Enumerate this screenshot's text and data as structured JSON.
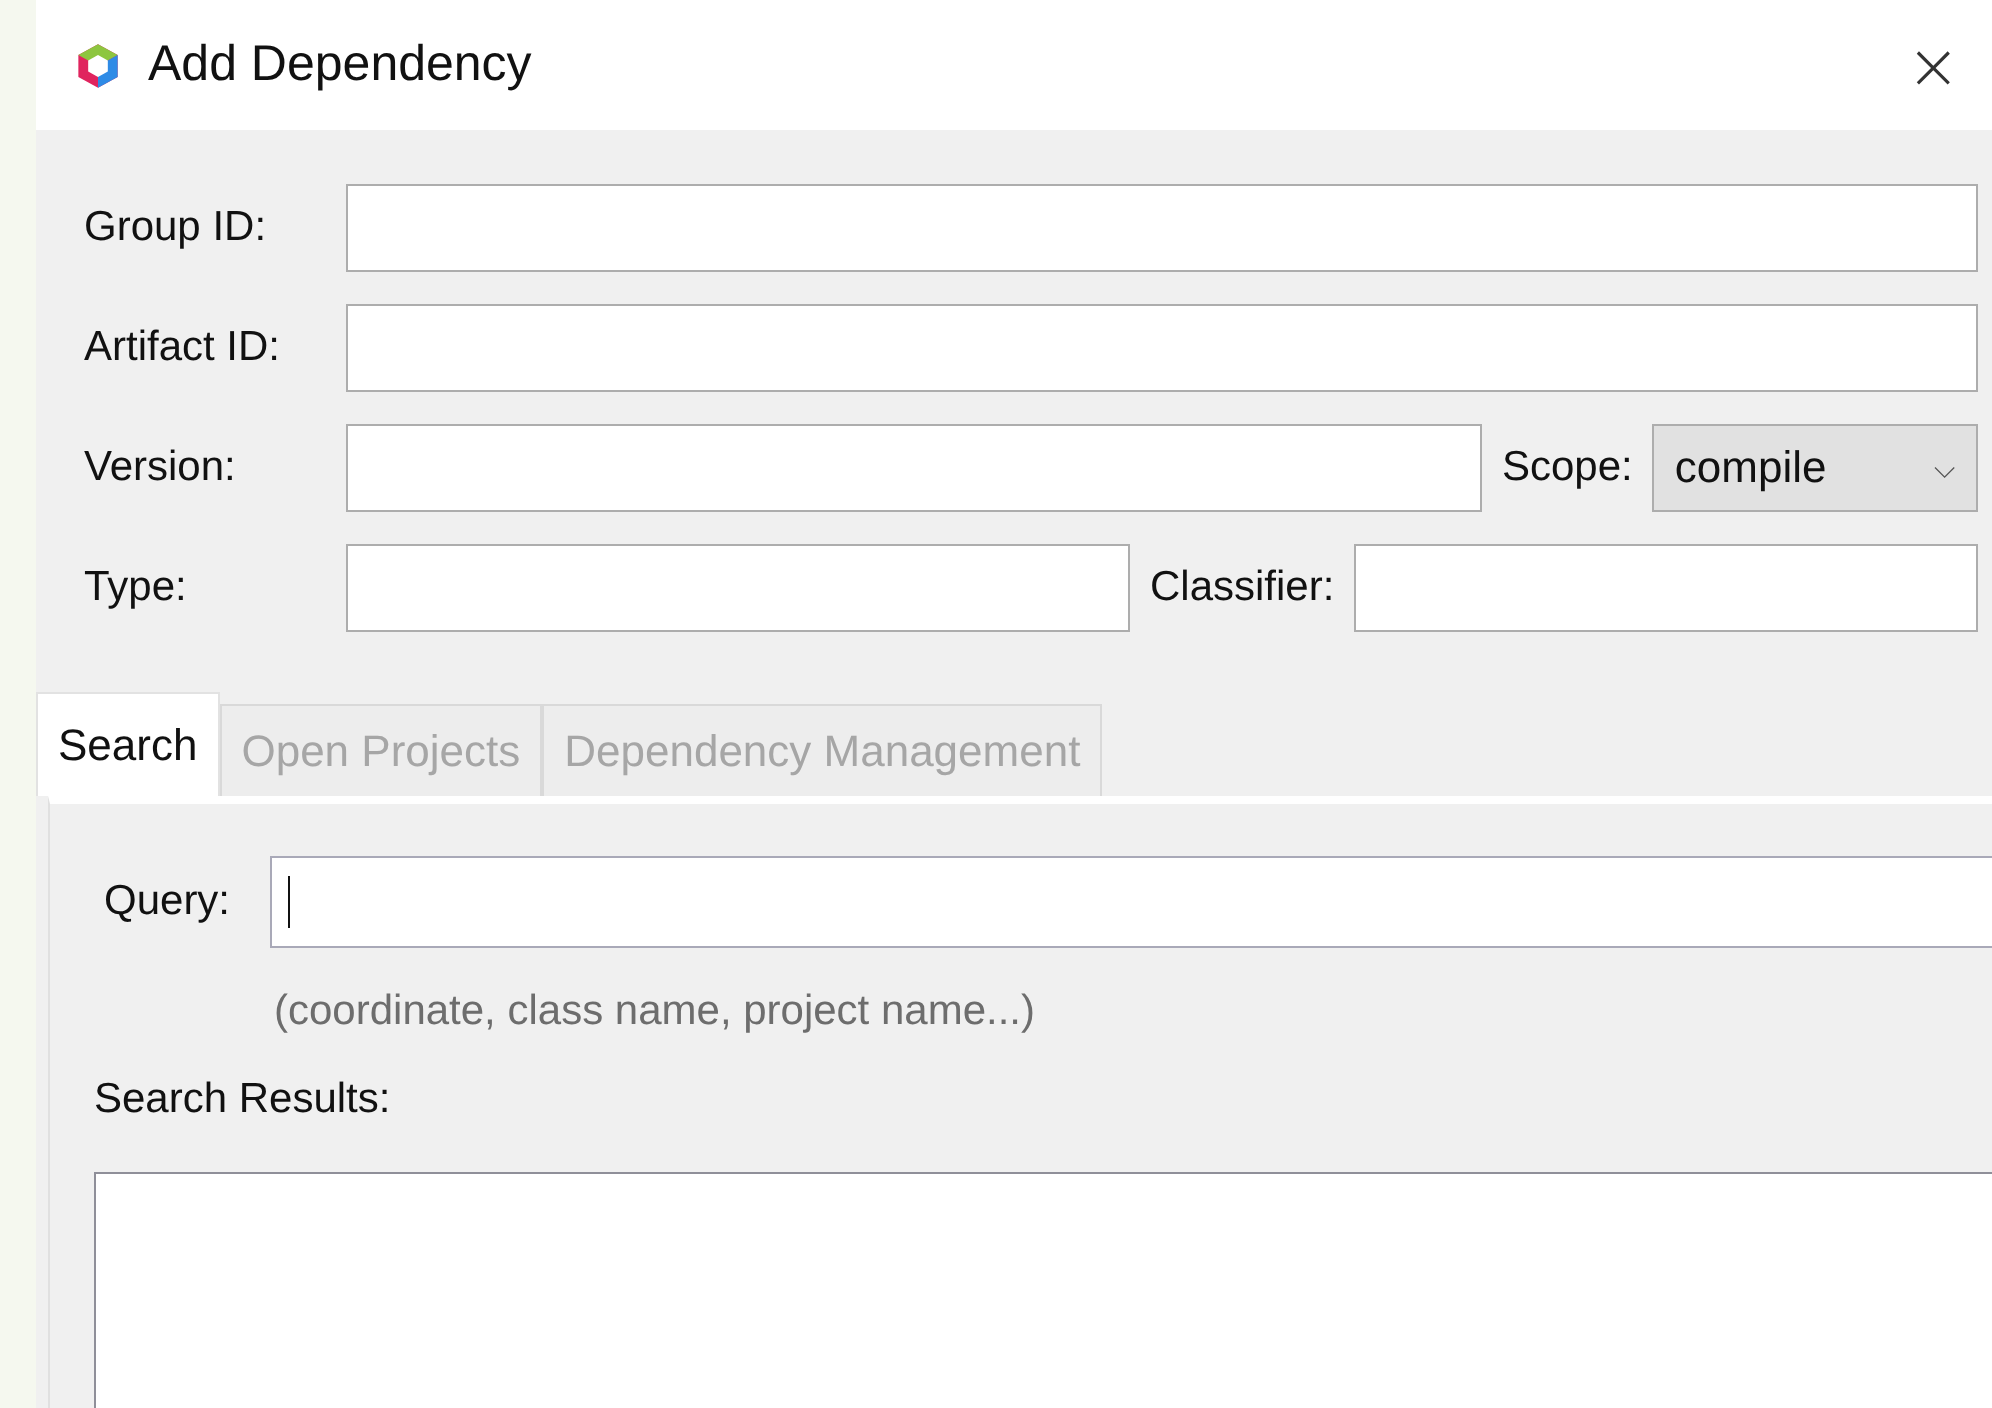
{
  "window": {
    "title": "Add Dependency",
    "close": "×"
  },
  "fields": [
    {
      "kind": "text",
      "label": "Group ID:"
    },
    {
      "kind": "text",
      "label": "Artifact ID:"
    },
    {
      "kind": "version",
      "label": "Version:",
      "extra_label": "Scope:",
      "value": "compile",
      "caret": "⌵"
    },
    {
      "kind": "type",
      "label": "Type:",
      "extra_label": "Classifier:"
    }
  ],
  "tabs": [
    {
      "label": "Search",
      "selected": true,
      "disabled": false
    },
    {
      "label": "Open Projects",
      "selected": false,
      "disabled": true
    },
    {
      "label": "Dependency Management",
      "selected": false,
      "disabled": true
    }
  ],
  "search": {
    "label": "Query:",
    "focused": true,
    "hint": "(coordinate, class name, project name...)",
    "results_label": "Search Results:"
  }
}
